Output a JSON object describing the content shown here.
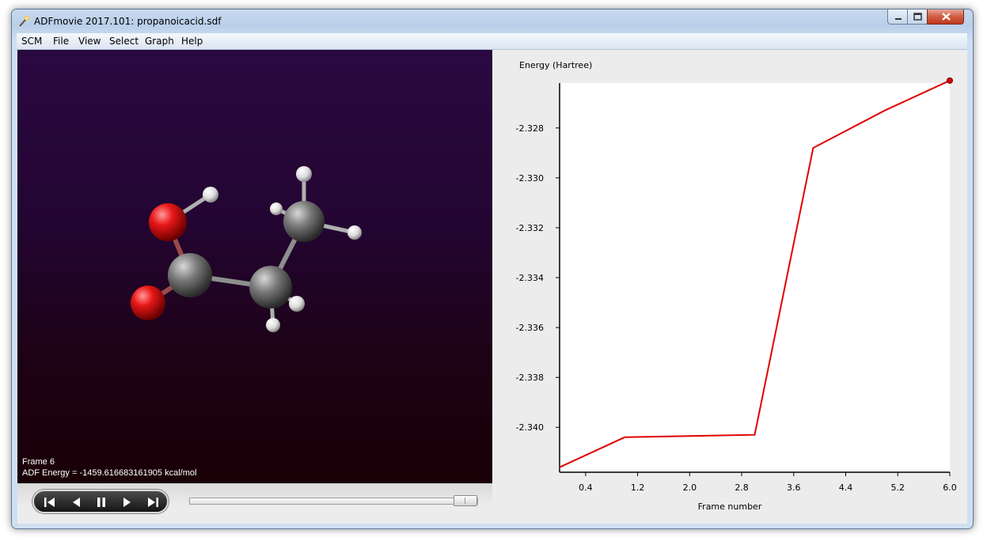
{
  "window": {
    "title": "ADFmovie 2017.101: propanoicacid.sdf",
    "app_icon": "wand-icon"
  },
  "menu": {
    "items": [
      "SCM",
      "File",
      "View",
      "Select",
      "Graph",
      "Help"
    ]
  },
  "viewport": {
    "frame_text": "Frame 6",
    "energy_text": "ADF Energy = -1459.616683161905 kcal/mol",
    "background_top": "#2a0941",
    "background_bottom": "#1a0006"
  },
  "player": {
    "buttons": [
      "skip-to-start-icon",
      "step-back-icon",
      "pause-icon",
      "step-forward-icon",
      "skip-to-end-icon"
    ],
    "slider_position": 0.97
  },
  "chart_data": {
    "type": "line",
    "title": "",
    "ylabel": "Energy (Hartree)",
    "xlabel": "Frame number",
    "x_ticks": [
      "0.4",
      "1.2",
      "2.0",
      "2.8",
      "3.6",
      "4.4",
      "5.2",
      "6.0"
    ],
    "y_ticks": [
      "-2.328",
      "-2.330",
      "-2.332",
      "-2.334",
      "-2.336",
      "-2.338",
      "-2.340"
    ],
    "x_tick_values": [
      0.4,
      1.2,
      2.0,
      2.8,
      3.6,
      4.4,
      5.2,
      6.0
    ],
    "y_tick_values": [
      -2.328,
      -2.33,
      -2.332,
      -2.334,
      -2.336,
      -2.338,
      -2.34
    ],
    "xlim": [
      0.0,
      6.0
    ],
    "ylim": [
      -2.3418,
      -2.3262
    ],
    "series": [
      {
        "color": "#e00000",
        "x": [
          0.0,
          1.0,
          3.0,
          3.9,
          5.0,
          6.0
        ],
        "y": [
          -2.3416,
          -2.3404,
          -2.3403,
          -2.3288,
          -2.3273,
          -2.3261
        ]
      }
    ],
    "current_point": {
      "x": 6.0,
      "y": -2.3261
    },
    "grid": false
  }
}
